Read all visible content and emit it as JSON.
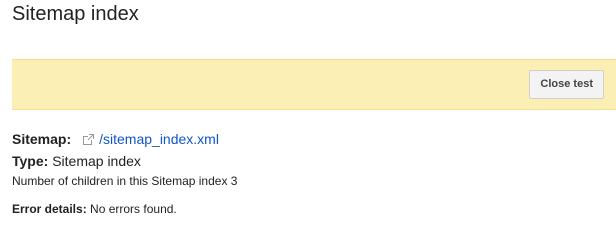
{
  "header": {
    "title": "Sitemap index"
  },
  "notice": {
    "close_label": "Close test"
  },
  "details": {
    "sitemap_label": "Sitemap:",
    "sitemap_link": "/sitemap_index.xml",
    "sitemap_link_icon": "external-link-icon",
    "type_label": "Type:",
    "type_value": "Sitemap index",
    "children_text": "Number of children in this Sitemap index 3",
    "errors_label": "Error details:",
    "errors_value": "No errors found."
  },
  "colors": {
    "notice_background": "#fcefb5",
    "link": "#1155cc"
  }
}
